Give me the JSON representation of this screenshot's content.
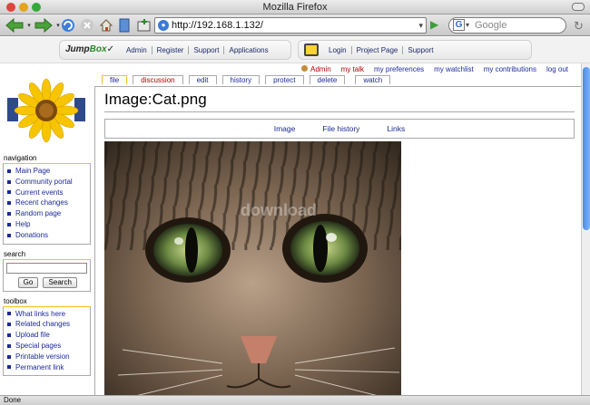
{
  "window": {
    "title": "Mozilla Firefox"
  },
  "browser": {
    "url": "http://192.168.1.132/",
    "search_placeholder": "Google",
    "status": "Done"
  },
  "jumpbox": {
    "logo_text_a": "Jump",
    "logo_text_b": "Box",
    "left_links": [
      "Admin",
      "Register",
      "Support",
      "Applications"
    ],
    "right_links": [
      "Login",
      "Project Page",
      "Support"
    ]
  },
  "personal_tools": {
    "user": "Admin",
    "talk": "my talk",
    "prefs": "my preferences",
    "watchlist": "my watchlist",
    "contribs": "my contributions",
    "logout": "log out"
  },
  "tabs": {
    "file": "file",
    "discussion": "discussion",
    "edit": "edit",
    "history": "history",
    "protect": "protect",
    "delete": "delete",
    "watch": "watch"
  },
  "page": {
    "title": "Image:Cat.png",
    "toc": [
      "Image",
      "File history",
      "Links"
    ],
    "watermark": "download"
  },
  "sidebar": {
    "navigation_title": "navigation",
    "navigation": [
      "Main Page",
      "Community portal",
      "Current events",
      "Recent changes",
      "Random page",
      "Help",
      "Donations"
    ],
    "search_title": "search",
    "go": "Go",
    "search": "Search",
    "toolbox_title": "toolbox",
    "toolbox": [
      "What links here",
      "Related changes",
      "Upload file",
      "Special pages",
      "Printable version",
      "Permanent link"
    ]
  }
}
